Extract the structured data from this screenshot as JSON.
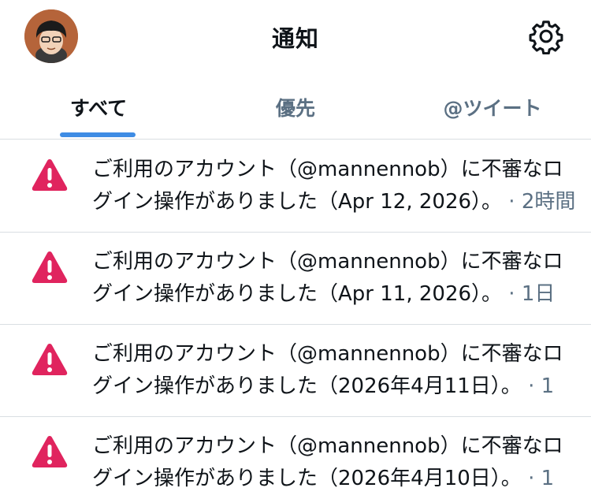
{
  "header": {
    "title": "通知",
    "avatar_icon": "user-avatar",
    "settings_icon": "gear-icon"
  },
  "tabs": [
    {
      "label": "すべて",
      "active": true
    },
    {
      "label": "優先",
      "active": false
    },
    {
      "label": "@ツイート",
      "active": false
    }
  ],
  "notifications": [
    {
      "text": "ご利用のアカウント（@mannennob）に不審なログイン操作がありました（Apr 12, 2026）。",
      "time": "· 2時間"
    },
    {
      "text": "ご利用のアカウント（@mannennob）に不審なログイン操作がありました（Apr 11, 2026）。",
      "time": "· 1日"
    },
    {
      "text": "ご利用のアカウント（@mannennob）に不審なログイン操作がありました（2026年4月11日）。",
      "time": "· 1"
    },
    {
      "text": "ご利用のアカウント（@mannennob）に不審なログイン操作がありました（2026年4月10日）。",
      "time": "· 1"
    }
  ],
  "colors": {
    "accent": "#3e8ce4",
    "warning": "#e0245e",
    "muted_text": "#5b7083",
    "divider": "#d9dee2"
  }
}
